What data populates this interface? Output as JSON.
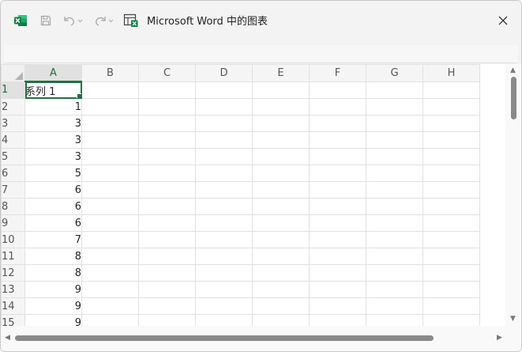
{
  "window": {
    "title": "Microsoft Word 中的图表",
    "icons": {
      "app": "excel-icon",
      "save": "save-icon",
      "undo": "undo-icon",
      "redo": "redo-icon",
      "edit_data": "edit-data-in-excel-icon",
      "close": "close-icon"
    },
    "colors": {
      "accent": "#1e7145"
    }
  },
  "sheet": {
    "columns": [
      "A",
      "B",
      "C",
      "D",
      "E",
      "F",
      "G",
      "H"
    ],
    "rows": [
      {
        "num": "1",
        "a": "系列 1"
      },
      {
        "num": "2",
        "a": "1"
      },
      {
        "num": "3",
        "a": "3"
      },
      {
        "num": "4",
        "a": "3"
      },
      {
        "num": "5",
        "a": "3"
      },
      {
        "num": "6",
        "a": "5"
      },
      {
        "num": "7",
        "a": "6"
      },
      {
        "num": "8",
        "a": "6"
      },
      {
        "num": "9",
        "a": "6"
      },
      {
        "num": "10",
        "a": "7"
      },
      {
        "num": "11",
        "a": "8"
      },
      {
        "num": "12",
        "a": "8"
      },
      {
        "num": "13",
        "a": "9"
      },
      {
        "num": "14",
        "a": "9"
      },
      {
        "num": "15",
        "a": "9"
      }
    ]
  }
}
